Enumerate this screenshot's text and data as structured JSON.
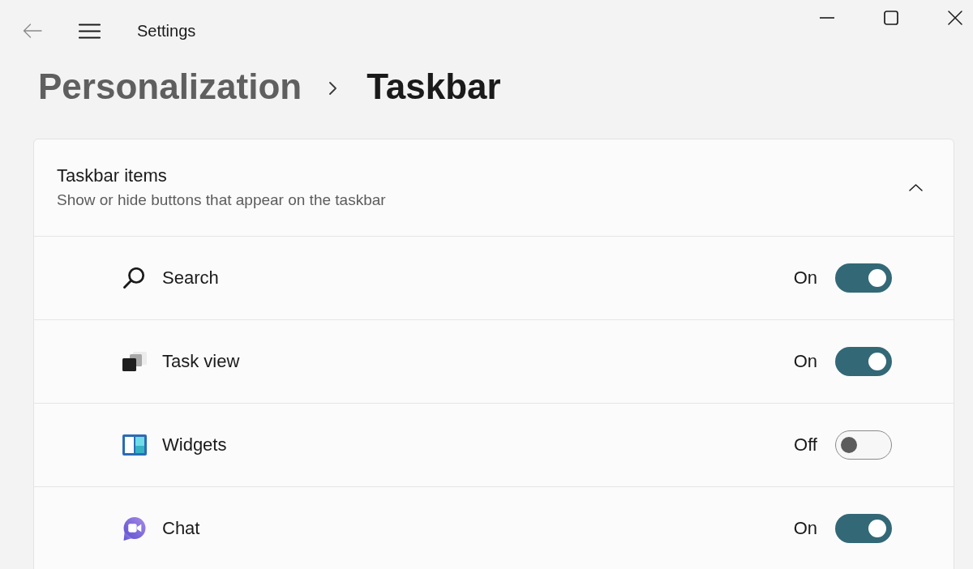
{
  "window": {
    "title": "Settings"
  },
  "breadcrumb": {
    "parent": "Personalization",
    "current": "Taskbar"
  },
  "section": {
    "title": "Taskbar items",
    "subtitle": "Show or hide buttons that appear on the taskbar",
    "expanded": true,
    "items": [
      {
        "kind": "search",
        "label": "Search",
        "state_label": "On",
        "on": true
      },
      {
        "kind": "task-view",
        "label": "Task view",
        "state_label": "On",
        "on": true
      },
      {
        "kind": "widgets",
        "label": "Widgets",
        "state_label": "Off",
        "on": false
      },
      {
        "kind": "chat",
        "label": "Chat",
        "state_label": "On",
        "on": true
      }
    ]
  }
}
